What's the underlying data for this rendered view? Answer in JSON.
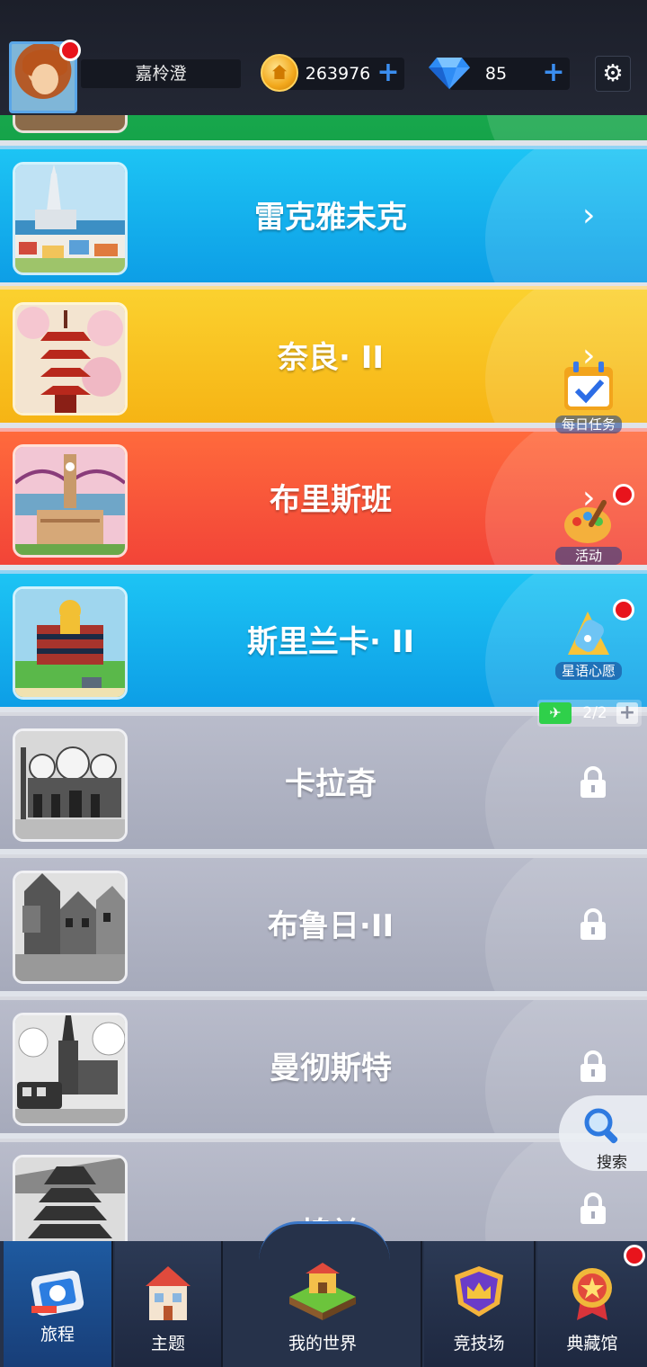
{
  "header": {
    "username": "嘉柃澄",
    "coins": "263976",
    "gems": "85",
    "add_label": "+"
  },
  "cities": [
    {
      "name": "",
      "state": "partial"
    },
    {
      "name": "雷克雅未克",
      "state": "unlocked"
    },
    {
      "name": "奈良· II",
      "state": "unlocked"
    },
    {
      "name": "布里斯班",
      "state": "unlocked"
    },
    {
      "name": "斯里兰卡· II",
      "state": "unlocked"
    },
    {
      "name": "卡拉奇",
      "state": "locked"
    },
    {
      "name": "布鲁日·II",
      "state": "locked"
    },
    {
      "name": "曼彻斯特",
      "state": "locked"
    },
    {
      "name": "棉兰",
      "state": "locked"
    }
  ],
  "side_widgets": {
    "daily_tasks": "每日任务",
    "events": "活动",
    "star_wish": "星语心愿",
    "search": "搜索",
    "flights": "2/2"
  },
  "bottom_nav": [
    {
      "label": "旅程",
      "active": true
    },
    {
      "label": "主题",
      "active": false
    },
    {
      "label": "我的世界",
      "active": false
    },
    {
      "label": "竞技场",
      "active": false
    },
    {
      "label": "典藏馆",
      "active": false
    }
  ],
  "colors": {
    "green": "#1db954",
    "blue": "#1dc4f4",
    "yellow": "#fbd12f",
    "red": "#f24438",
    "locked": "#b0b4c4",
    "notification": "#e8141c"
  },
  "icons": {
    "coin": "coin-icon",
    "gem": "diamond-icon",
    "settings": "gear-icon",
    "lock": "lock-icon",
    "arrow": "chevron-right-icon",
    "search": "magnifier-icon",
    "plane": "plane-icon"
  }
}
